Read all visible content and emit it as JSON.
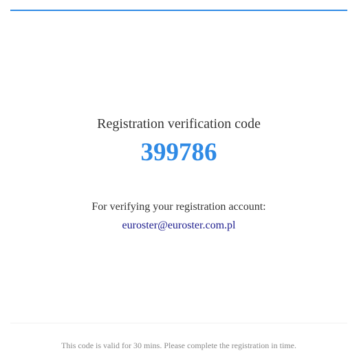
{
  "email_card": {
    "title": "Registration verification code",
    "code": "399786",
    "subtitle": "For verifying your registration account:",
    "email": "euroster@euroster.com.pl",
    "footer": "This code is valid for 30 mins. Please complete the registration in time."
  },
  "colors": {
    "accent": "#2f8ae5",
    "email_link": "#1a1a8c",
    "text": "#333333",
    "footer_text": "#8a8a8a"
  }
}
